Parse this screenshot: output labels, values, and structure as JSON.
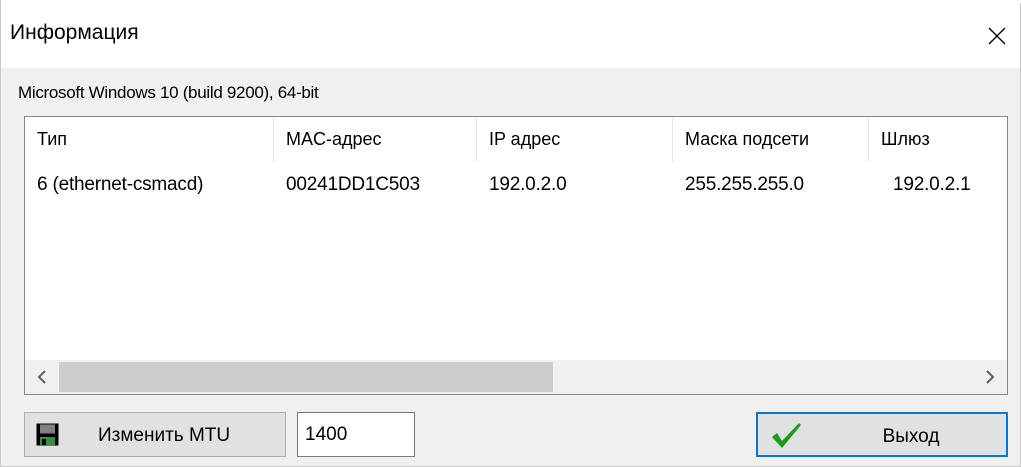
{
  "window": {
    "title": "Информация",
    "close_icon": "close-icon"
  },
  "os_info": "Microsoft Windows 10  (build 9200), 64-bit",
  "adapters_table": {
    "columns": [
      "Тип",
      "MAC-адрес",
      "IP адрес",
      "Маска подсети",
      "Шлюз"
    ],
    "rows": [
      [
        "6 (ethernet-csmacd)",
        "00241DD1C503",
        "192.0.2.0",
        "255.255.255.0",
        "192.0.2.1"
      ]
    ],
    "scroll_left_icon": "chevron-left-icon",
    "scroll_right_icon": "chevron-right-icon"
  },
  "footer": {
    "change_mtu_label": "Изменить MTU",
    "change_mtu_icon": "floppy-disk-icon",
    "mtu_value": "1400",
    "exit_label": "Выход",
    "exit_icon": "checkmark-icon"
  },
  "colors": {
    "accent": "#0078d7",
    "check_green": "#1a9e1a",
    "button_face": "#e1e1e1"
  }
}
